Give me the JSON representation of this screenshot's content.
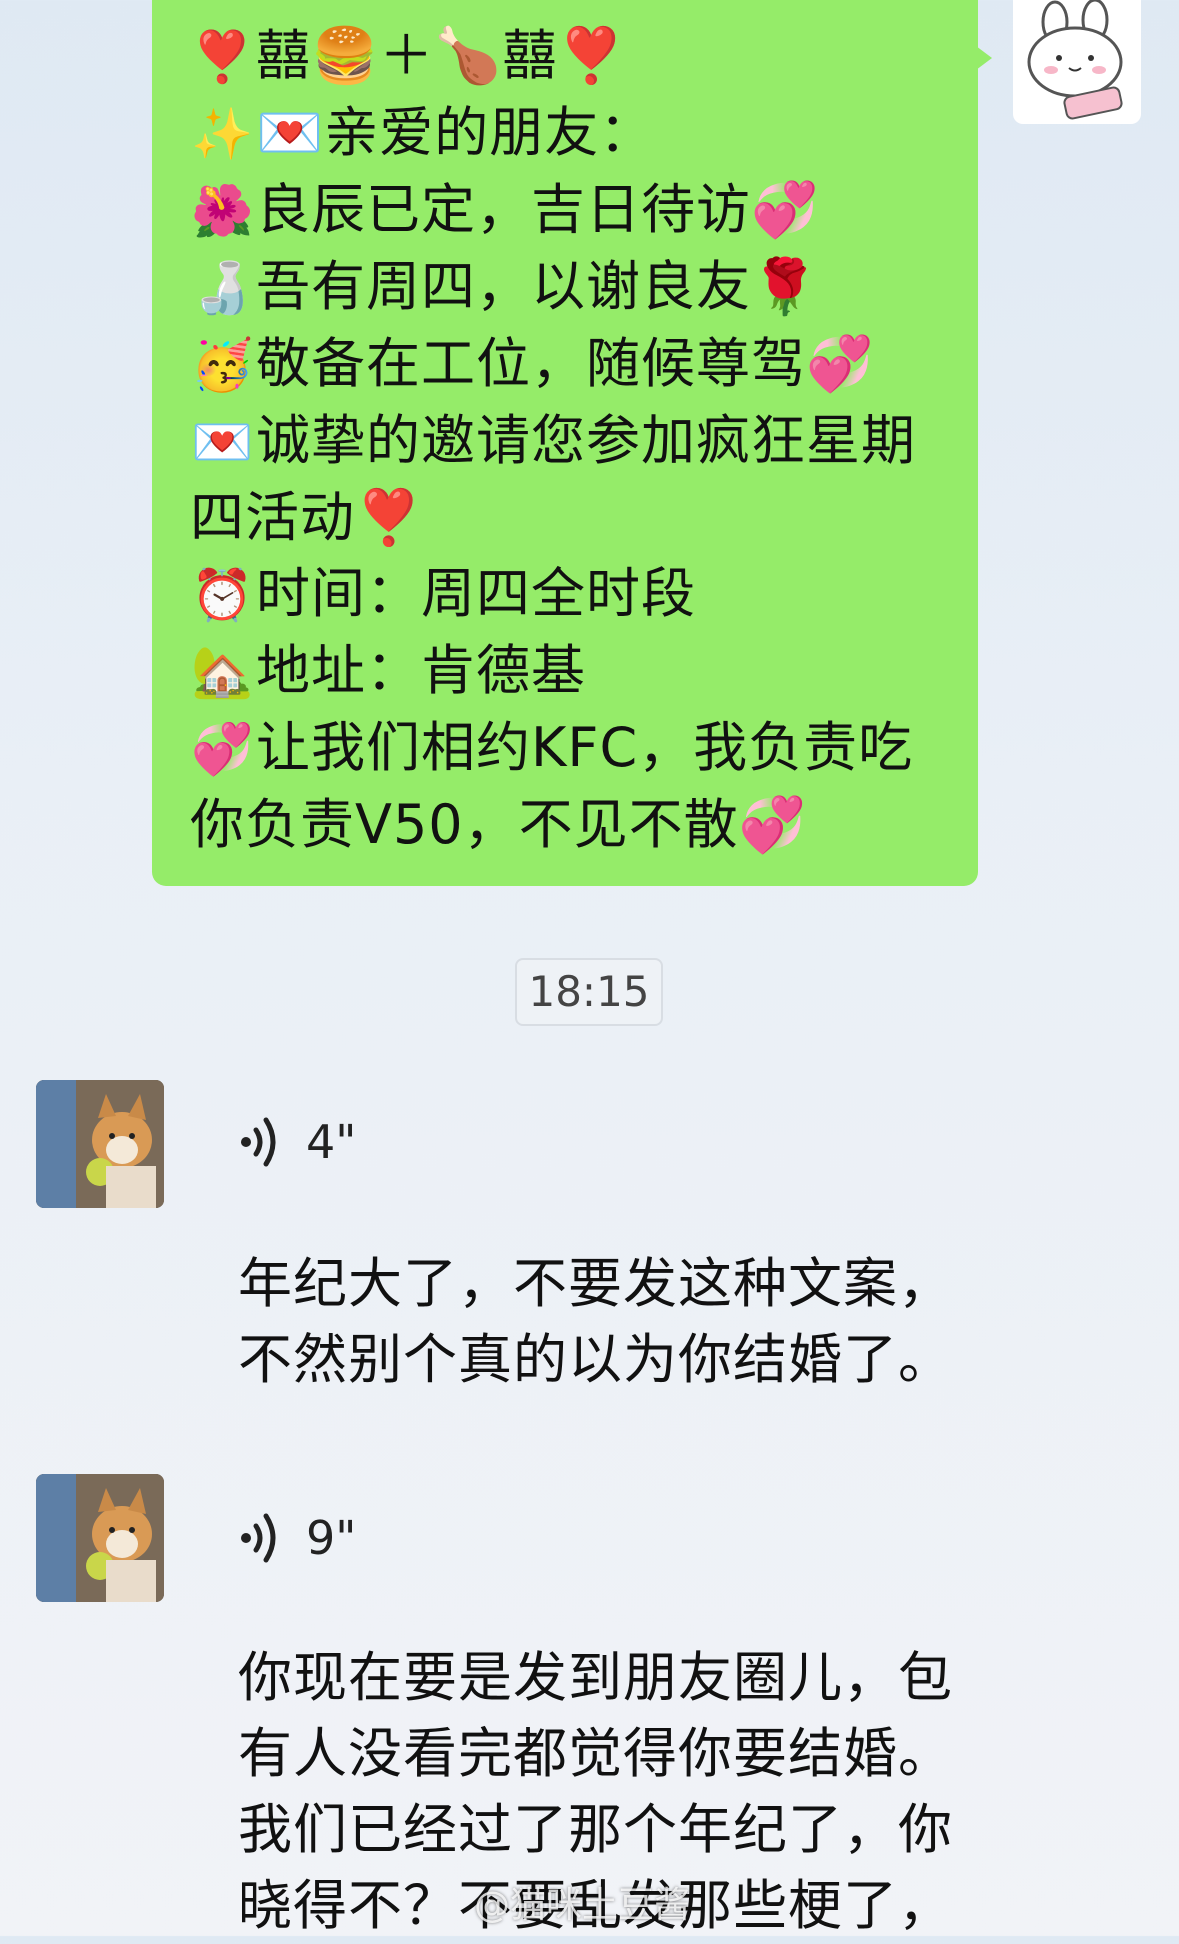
{
  "sent_message": {
    "lines": [
      {
        "emoji": "❣️",
        "text": "囍🍔＋🍗囍❣️"
      },
      {
        "emoji": "✨",
        "text": "💌亲爱的朋友："
      },
      {
        "emoji": "🌺",
        "text": "良辰已定，吉日待访💞"
      },
      {
        "emoji": "🍶",
        "text": "吾有周四，以谢良友🌹"
      },
      {
        "emoji": "🥳",
        "text": "敬备在工位，随候尊驾💞"
      },
      {
        "emoji": "💌",
        "text": "诚挚的邀请您参加疯狂星期"
      },
      {
        "emoji": "",
        "text": "四活动❣️"
      },
      {
        "emoji": "⏰",
        "text": "时间：周四全时段"
      },
      {
        "emoji": "🏡",
        "text": "地址：肯德基"
      },
      {
        "emoji": "💞",
        "text": "让我们相约KFC，我负责吃"
      },
      {
        "emoji": "",
        "text": "你负责V50，不见不散💞"
      }
    ]
  },
  "timestamp": "18:15",
  "voice_messages": [
    {
      "duration": "4\"",
      "transcript": [
        "年纪大了，不要发这种文案，",
        "不然别个真的以为你结婚了。"
      ]
    },
    {
      "duration": "9\"",
      "transcript": [
        "你现在要是发到朋友圈儿，包",
        "有人没看完都觉得你要结婚。",
        "我们已经过了那个年纪了，你",
        "晓得不？不要乱发那些梗了，"
      ]
    }
  ],
  "watermark": "@猫咪土豆酱",
  "colors": {
    "sent_bubble": "#95ec69",
    "background": "#e9eff6"
  },
  "icons": {
    "self_avatar": "bunny-sticker-icon",
    "friend_avatar": "corgi-photo",
    "voice": "voice-wave-icon"
  }
}
